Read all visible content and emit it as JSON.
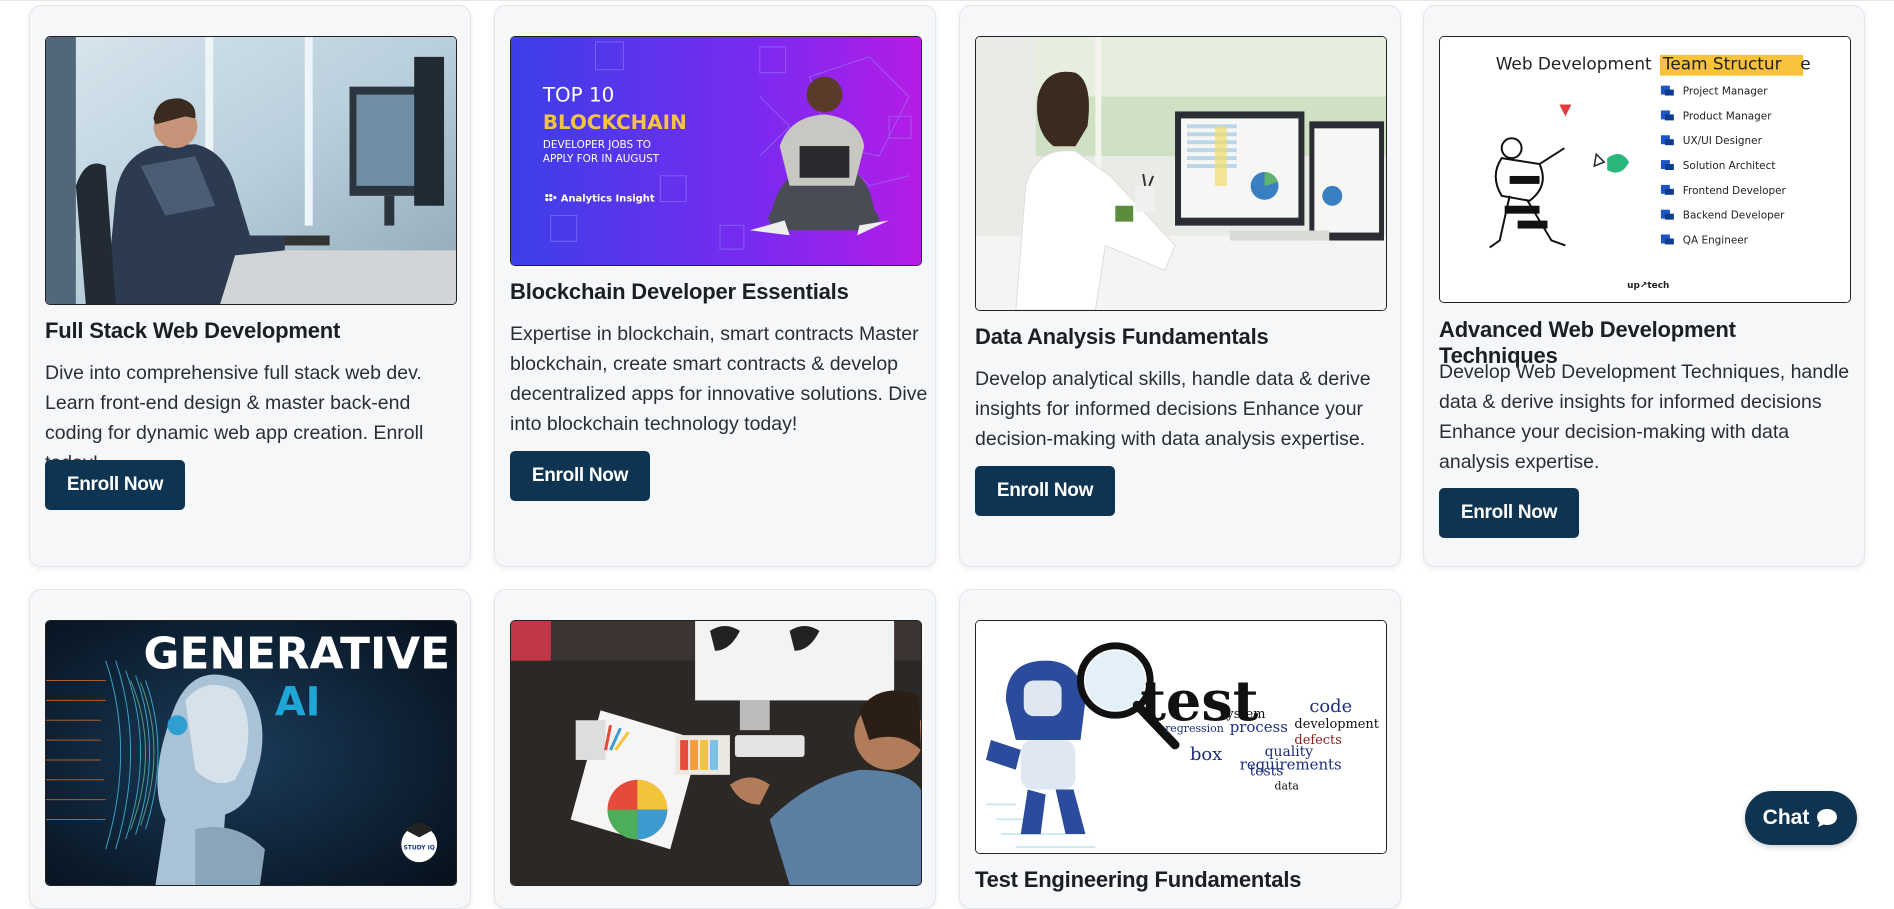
{
  "courses": [
    {
      "title": "Full Stack Web Development",
      "description": "Dive into comprehensive full stack web dev. Learn front-end design & master back-end coding for dynamic web app creation. Enroll today!",
      "button": "Enroll Now",
      "image": {
        "kind": "photo",
        "subject": "man at desk with computer monitors"
      }
    },
    {
      "title": "Blockchain Developer Essentials",
      "description": "Expertise in blockchain, smart contracts Master blockchain, create smart contracts & develop decentralized apps for innovative solutions. Dive into blockchain technology today!",
      "button": "Enroll Now",
      "image": {
        "kind": "banner",
        "line1": "TOP 10",
        "line2": "BLOCKCHAIN",
        "line3": "DEVELOPER JOBS TO",
        "line4": "APPLY FOR IN AUGUST",
        "brand": "Analytics Insight"
      }
    },
    {
      "title": "Data Analysis Fundamentals",
      "description": "Develop analytical skills, handle data & derive insights for informed decisions Enhance your decision-making with data analysis expertise.",
      "button": "Enroll Now",
      "image": {
        "kind": "photo",
        "subject": "woman analysing charts on monitors"
      }
    },
    {
      "title": "Advanced Web Development Techniques",
      "description": "Develop Web Development Techniques, handle data & derive insights for informed decisions Enhance your decision-making with data analysis expertise.",
      "button": "Enroll Now",
      "image": {
        "kind": "infographic",
        "heading_plain": "Web Development ",
        "heading_highlight": "Team Structur",
        "heading_tail": "e",
        "roles": [
          "Project Manager",
          "Product Manager",
          "UX/UI Designer",
          "Solution Architect",
          "Frontend Developer",
          "Backend Developer",
          "QA Engineer"
        ],
        "brand": "up↗tech"
      }
    },
    {
      "title": "",
      "description": "",
      "button": "",
      "image": {
        "kind": "banner",
        "line1": "GENERATIVE",
        "line2": "AI",
        "brand": "STUDY IQ"
      }
    },
    {
      "title": "",
      "description": "",
      "button": "",
      "image": {
        "kind": "photo",
        "subject": "designer working at desk with color swatches"
      }
    },
    {
      "title": "Test Engineering Fundamentals",
      "description": "",
      "button": "",
      "image": {
        "kind": "wordcloud",
        "words": [
          "test",
          "code",
          "requirements",
          "process",
          "development",
          "system",
          "quality",
          "box",
          "defects",
          "tests",
          "regression",
          "data"
        ]
      }
    }
  ],
  "chat": {
    "label": "Chat",
    "icon": "chat-bubble-icon"
  },
  "colors": {
    "button_bg": "#0f3451",
    "card_bg": "#f6f7f9",
    "highlight": "#f8c23c",
    "role_icon": "#1a56c4"
  }
}
